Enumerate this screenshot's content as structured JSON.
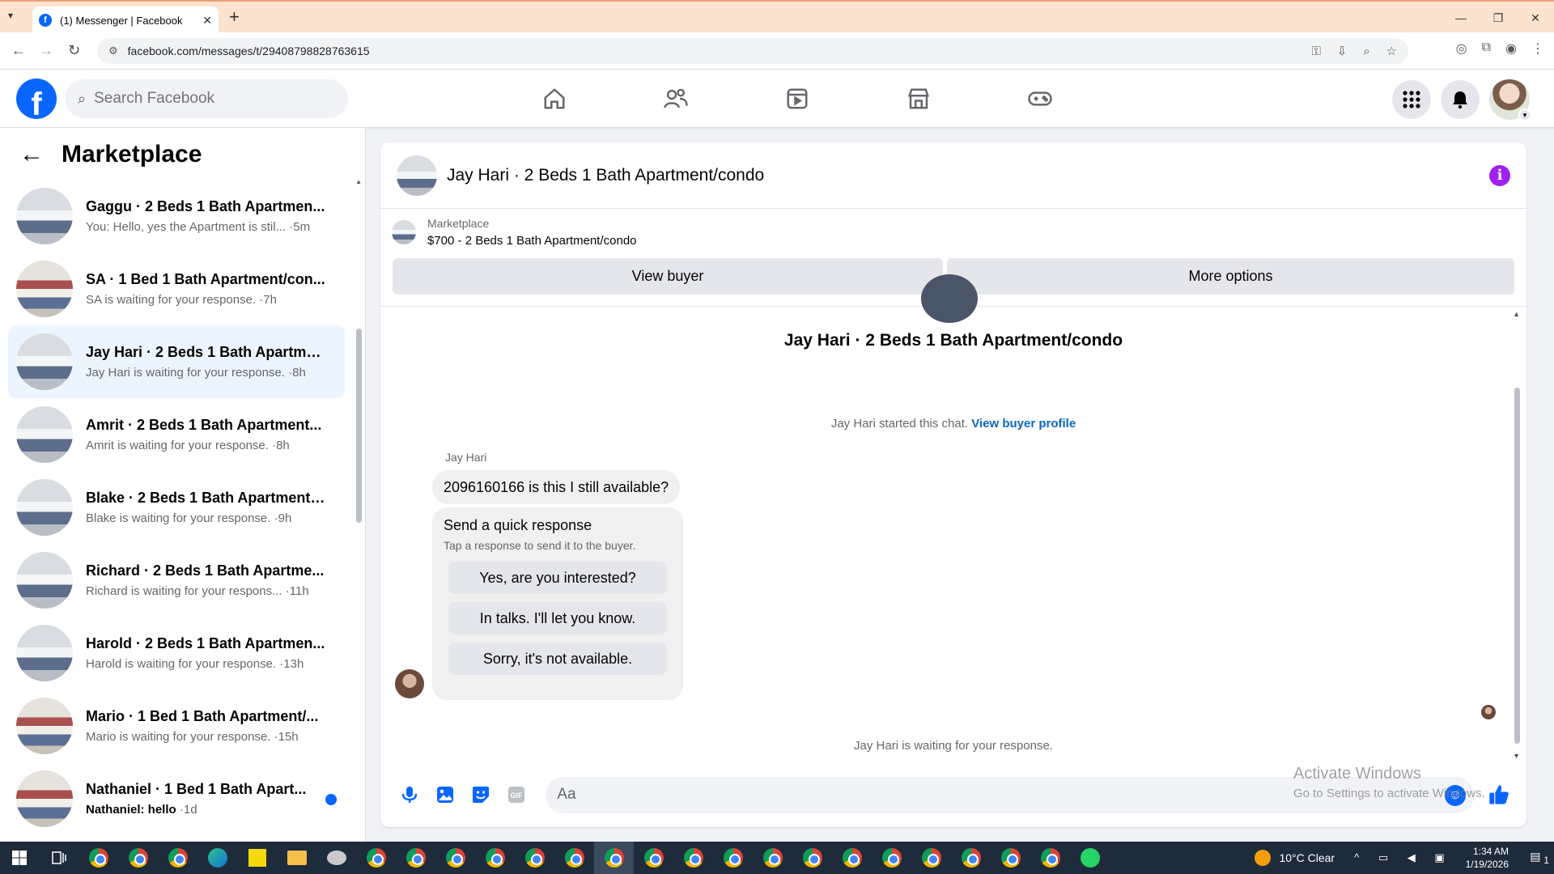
{
  "browser": {
    "tab_title": "(1) Messenger | Facebook",
    "url": "facebook.com/messages/t/29408798828763615"
  },
  "fb": {
    "search_placeholder": "Search Facebook",
    "brand_color": "#0866ff"
  },
  "sidebar": {
    "title": "Marketplace",
    "conversations": [
      {
        "name": "Gaggu · 2 Beds 1 Bath Apartmen...",
        "preview": "You: Hello, yes the Apartment is stil...",
        "time": "5m",
        "thumb": "bedroom-gray",
        "active": false,
        "unread": false
      },
      {
        "name": "SA · 1 Bed 1 Bath Apartment/con...",
        "preview": "SA is waiting for your response.",
        "time": "7h",
        "thumb": "bedroom-red",
        "active": false,
        "unread": false
      },
      {
        "name": "Jay Hari · 2 Beds 1 Bath Apartme...",
        "preview": "Jay Hari is waiting for your response.",
        "time": "8h",
        "thumb": "bedroom-gray",
        "active": true,
        "unread": false
      },
      {
        "name": "Amrit · 2 Beds 1 Bath Apartment...",
        "preview": "Amrit is waiting for your response.",
        "time": "8h",
        "thumb": "bedroom-gray",
        "active": false,
        "unread": false
      },
      {
        "name": "Blake · 2 Beds 1 Bath Apartment/...",
        "preview": "Blake is waiting for your response.",
        "time": "9h",
        "thumb": "bedroom-gray",
        "active": false,
        "unread": false
      },
      {
        "name": "Richard · 2 Beds 1 Bath Apartme...",
        "preview": "Richard is waiting for your respons...",
        "time": "11h",
        "thumb": "bedroom-gray",
        "active": false,
        "unread": false
      },
      {
        "name": "Harold · 2 Beds 1 Bath Apartmen...",
        "preview": "Harold is waiting for your response.",
        "time": "13h",
        "thumb": "bedroom-gray",
        "active": false,
        "unread": false
      },
      {
        "name": "Mario · 1 Bed 1 Bath Apartment/...",
        "preview": "Mario is waiting for your response.",
        "time": "15h",
        "thumb": "bedroom-red",
        "active": false,
        "unread": false
      },
      {
        "name": "Nathaniel · 1 Bed 1 Bath Apart...",
        "preview": "Nathaniel: hello",
        "time": "1d",
        "thumb": "bedroom-red",
        "active": false,
        "unread": true
      }
    ]
  },
  "chat": {
    "header_title": "Jay Hari · 2 Beds 1 Bath Apartment/condo",
    "listing_label": "Marketplace",
    "listing_price": "$700 - 2 Beds 1 Bath Apartment/condo",
    "view_buyer": "View buyer",
    "more_options": "More options",
    "big_title": "Jay Hari · 2 Beds 1 Bath Apartment/condo",
    "started_text": "Jay Hari started this chat.",
    "view_profile": "View buyer profile",
    "sender": "Jay Hari",
    "message": "2096160166 is this I still available?",
    "quick_title": "Send a quick response",
    "quick_sub": "Tap a response to send it to the buyer.",
    "quick_replies": [
      "Yes, are you interested?",
      "In talks. I'll let you know.",
      "Sorry, it's not available."
    ],
    "waiting_text": "Jay Hari is waiting for your response.",
    "composer_placeholder": "Aa"
  },
  "watermark": {
    "line1": "Activate Windows",
    "line2": "Go to Settings to activate Windows."
  },
  "taskbar": {
    "weather": "10°C  Clear",
    "time": "1:34 AM",
    "date": "1/19/2026",
    "notif_count": "1"
  }
}
